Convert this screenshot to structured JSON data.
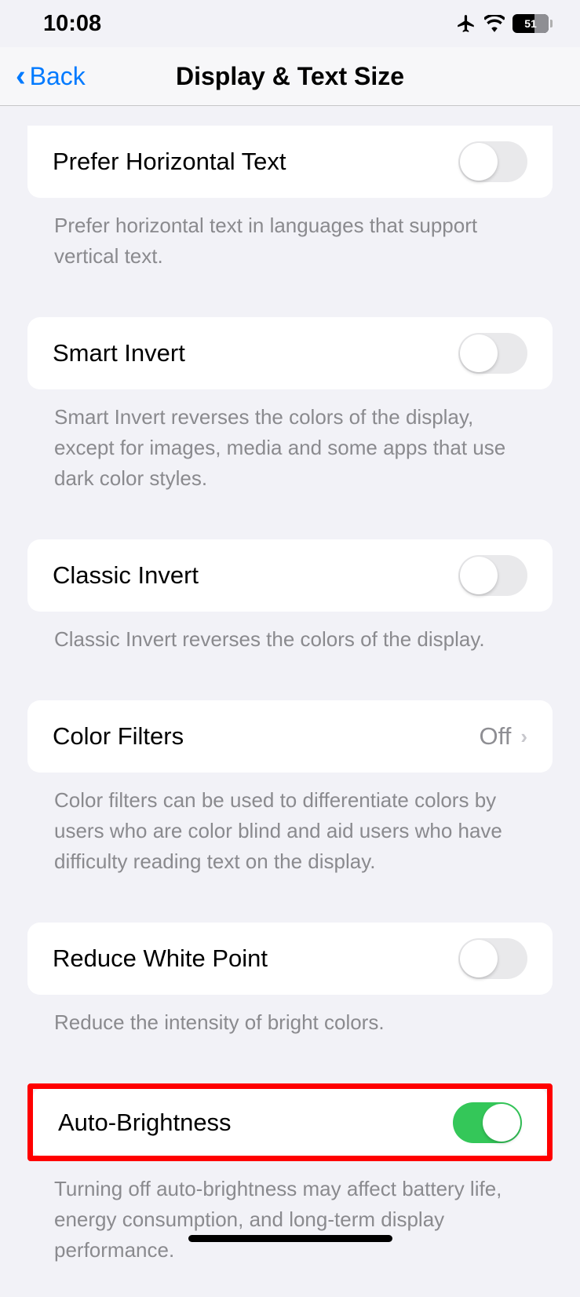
{
  "status_bar": {
    "time": "10:08",
    "battery": "51"
  },
  "nav": {
    "back_label": "Back",
    "title": "Display & Text Size"
  },
  "settings": {
    "prefer_horizontal": {
      "label": "Prefer Horizontal Text",
      "footer": "Prefer horizontal text in languages that support vertical text."
    },
    "smart_invert": {
      "label": "Smart Invert",
      "footer": "Smart Invert reverses the colors of the display, except for images, media and some apps that use dark color styles."
    },
    "classic_invert": {
      "label": "Classic Invert",
      "footer": "Classic Invert reverses the colors of the display."
    },
    "color_filters": {
      "label": "Color Filters",
      "value": "Off",
      "footer": "Color filters can be used to differentiate colors by users who are color blind and aid users who have difficulty reading text on the display."
    },
    "reduce_white_point": {
      "label": "Reduce White Point",
      "footer": "Reduce the intensity of bright colors."
    },
    "auto_brightness": {
      "label": "Auto-Brightness",
      "footer": "Turning off auto-brightness may affect battery life, energy consumption, and long-term display performance."
    }
  }
}
